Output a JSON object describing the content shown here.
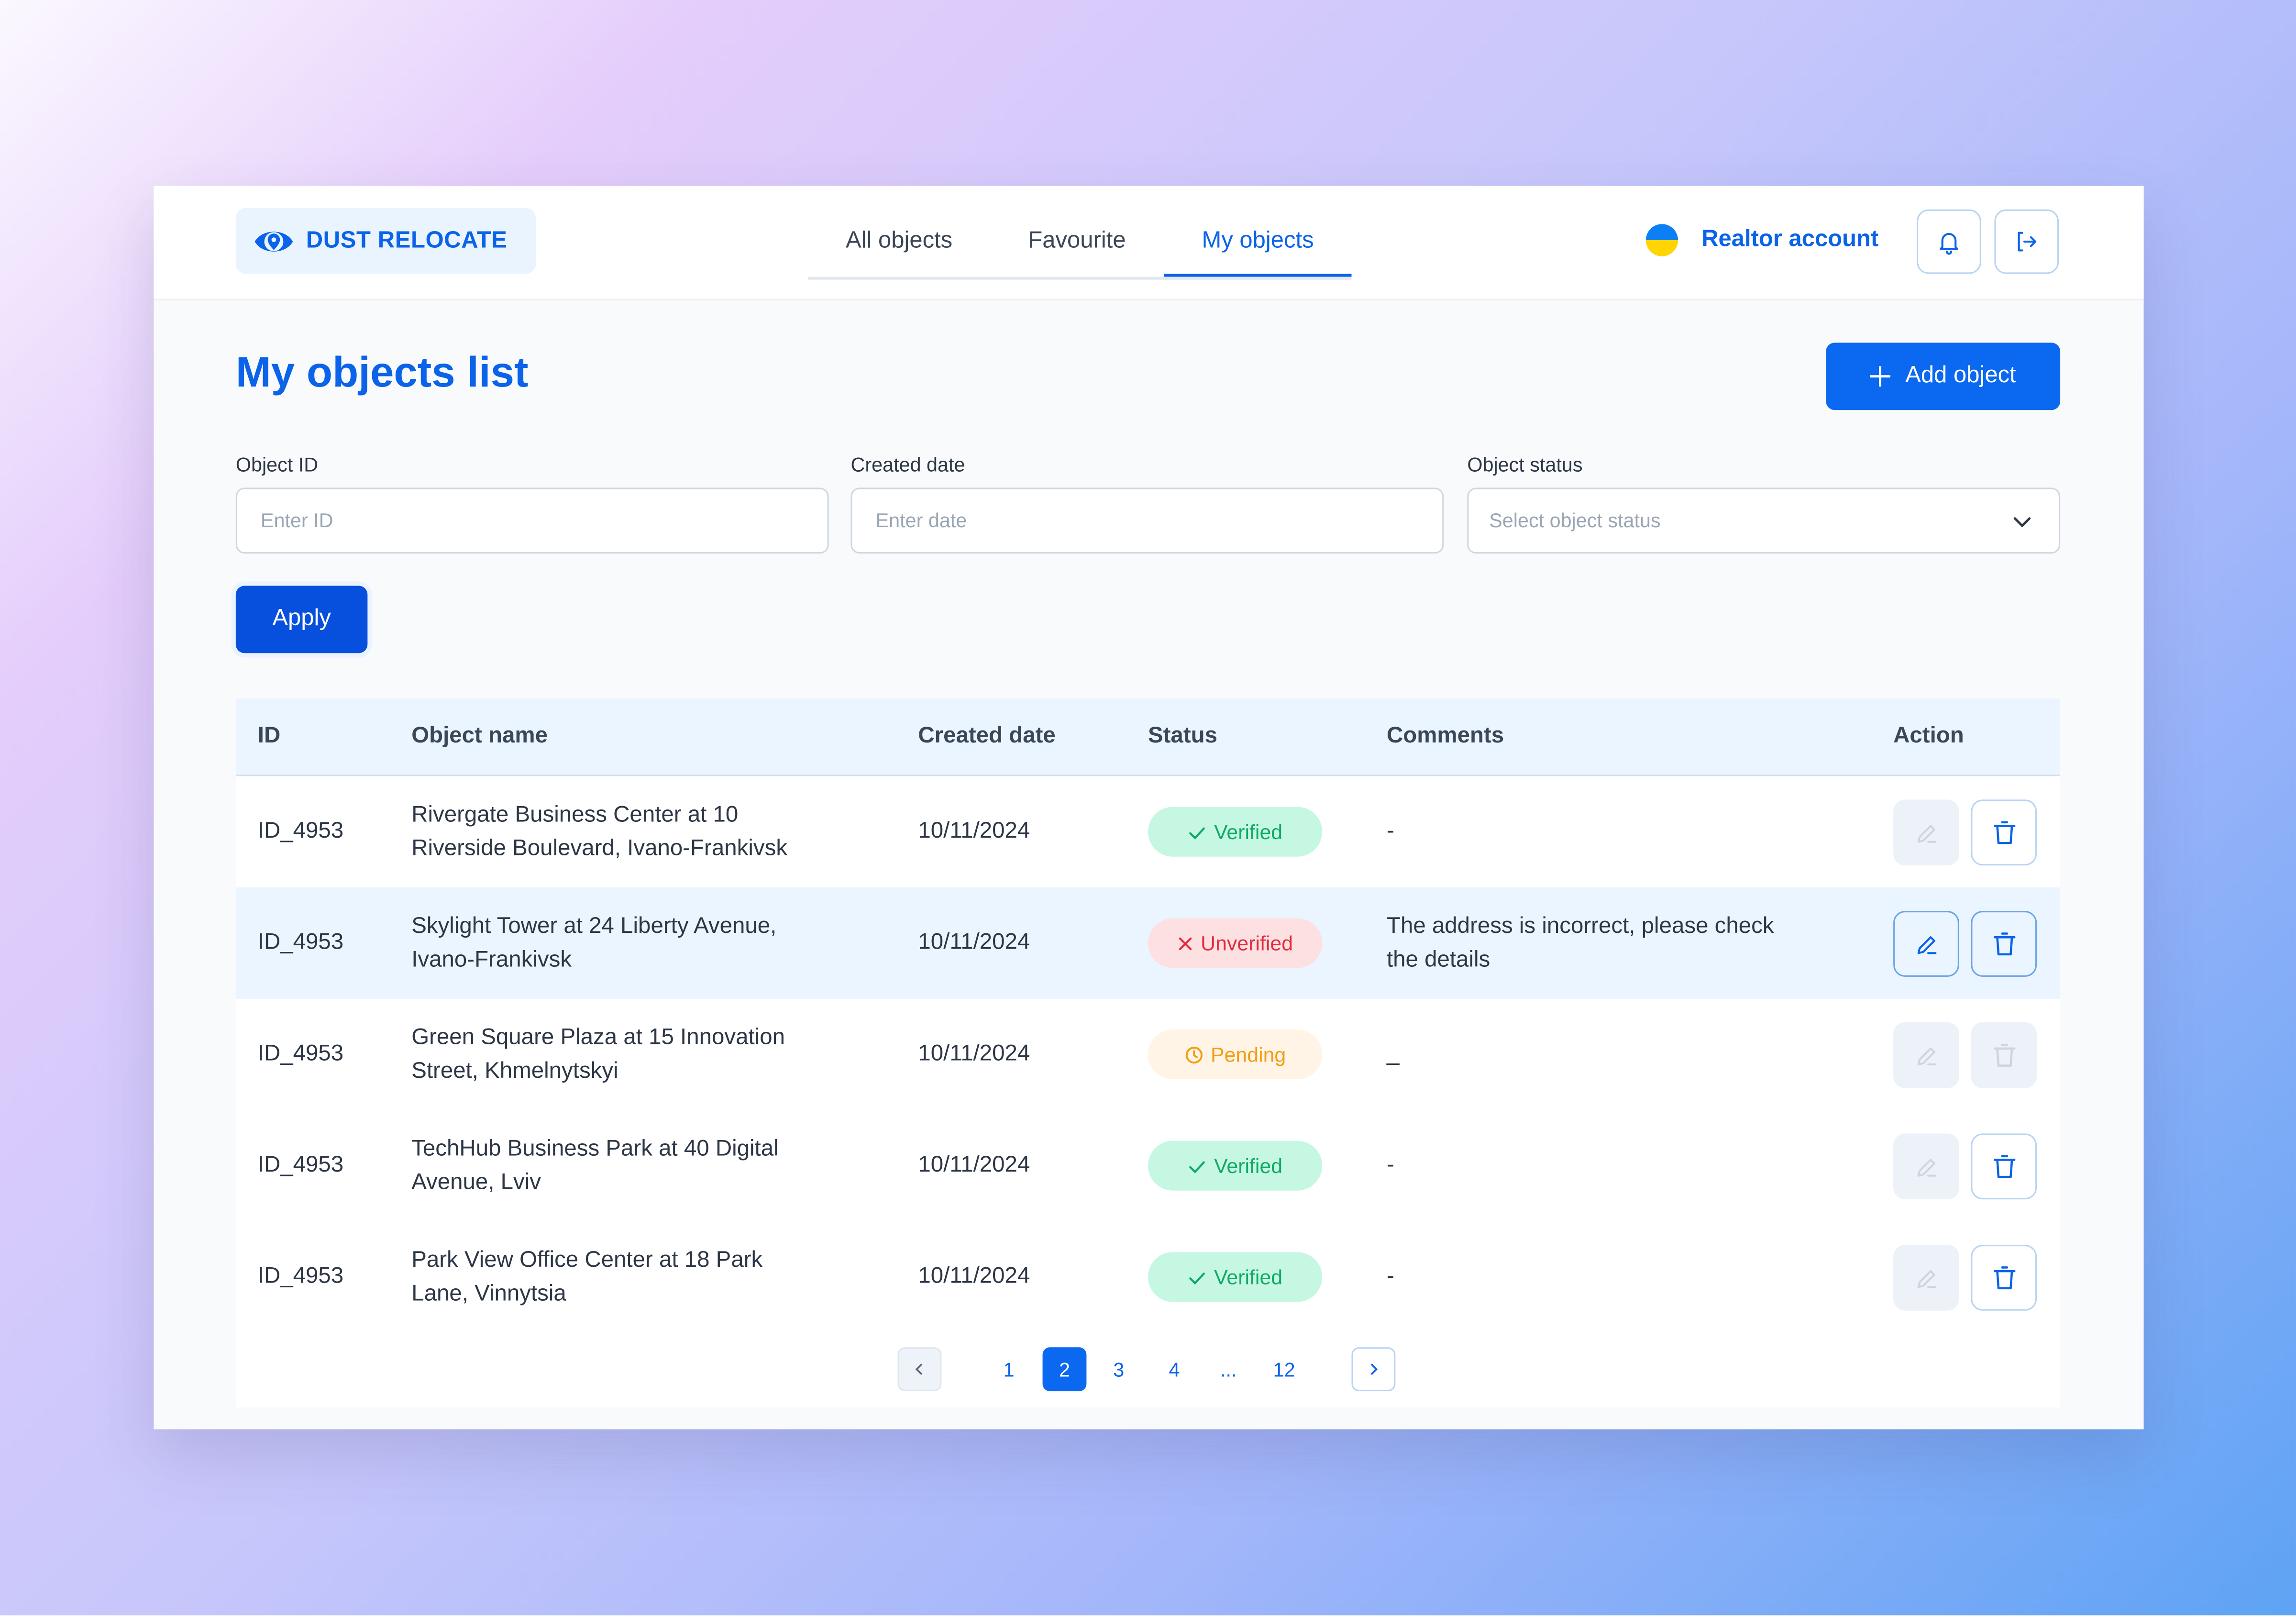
{
  "brand": {
    "name": "DUST RELOCATE",
    "color": "#0a63e8"
  },
  "nav": {
    "tabs": [
      {
        "label": "All objects",
        "active": false
      },
      {
        "label": "Favourite",
        "active": false
      },
      {
        "label": "My objects",
        "active": true
      }
    ]
  },
  "account": {
    "label": "Realtor account",
    "flag": "ukraine-flag-icon",
    "notification_icon": "bell-icon",
    "logout_icon": "logout-icon"
  },
  "page": {
    "title": "My objects list",
    "add_button": "Add object"
  },
  "filters": {
    "object_id": {
      "label": "Object ID",
      "placeholder": "Enter ID",
      "value": ""
    },
    "created_date": {
      "label": "Created date",
      "placeholder": "Enter date",
      "value": ""
    },
    "object_status": {
      "label": "Object status",
      "placeholder": "Select object status",
      "value": ""
    },
    "apply_label": "Apply"
  },
  "table": {
    "columns": [
      "ID",
      "Object name",
      "Created date",
      "Status",
      "Comments",
      "Action"
    ],
    "rows": [
      {
        "id": "ID_4953",
        "name_line1": "Rivergate Business Center at 10",
        "name_line2": "Riverside Boulevard, Ivano-Frankivsk",
        "date": "10/11/2024",
        "status": "Verified",
        "status_type": "verified",
        "comment_line1": "-",
        "comment_line2": "",
        "edit_enabled": false,
        "delete_enabled": true
      },
      {
        "id": "ID_4953",
        "name_line1": "Skylight Tower at 24 Liberty Avenue,",
        "name_line2": "Ivano-Frankivsk",
        "date": "10/11/2024",
        "status": "Unverified",
        "status_type": "unverified",
        "comment_line1": "The address is incorrect, please check",
        "comment_line2": "the details",
        "edit_enabled": true,
        "delete_enabled": true
      },
      {
        "id": "ID_4953",
        "name_line1": "Green Square Plaza at 15 Innovation",
        "name_line2": "Street, Khmelnytskyi",
        "date": "10/11/2024",
        "status": "Pending",
        "status_type": "pending",
        "comment_line1": "_",
        "comment_line2": "",
        "edit_enabled": false,
        "delete_enabled": false
      },
      {
        "id": "ID_4953",
        "name_line1": "TechHub Business Park at 40 Digital",
        "name_line2": "Avenue, Lviv",
        "date": "10/11/2024",
        "status": "Verified",
        "status_type": "verified",
        "comment_line1": "-",
        "comment_line2": "",
        "edit_enabled": false,
        "delete_enabled": true
      },
      {
        "id": "ID_4953",
        "name_line1": "Park View Office Center at 18 Park",
        "name_line2": "Lane, Vinnytsia",
        "date": "10/11/2024",
        "status": "Verified",
        "status_type": "verified",
        "comment_line1": "-",
        "comment_line2": "",
        "edit_enabled": false,
        "delete_enabled": true
      }
    ]
  },
  "pagination": {
    "current": "2",
    "items": [
      "1",
      "2",
      "3",
      "4",
      "...",
      "12"
    ]
  },
  "colors": {
    "accent": "#0a63e8",
    "verified": "#0fa968",
    "unverified": "#e42b3c",
    "pending": "#f29d13"
  }
}
